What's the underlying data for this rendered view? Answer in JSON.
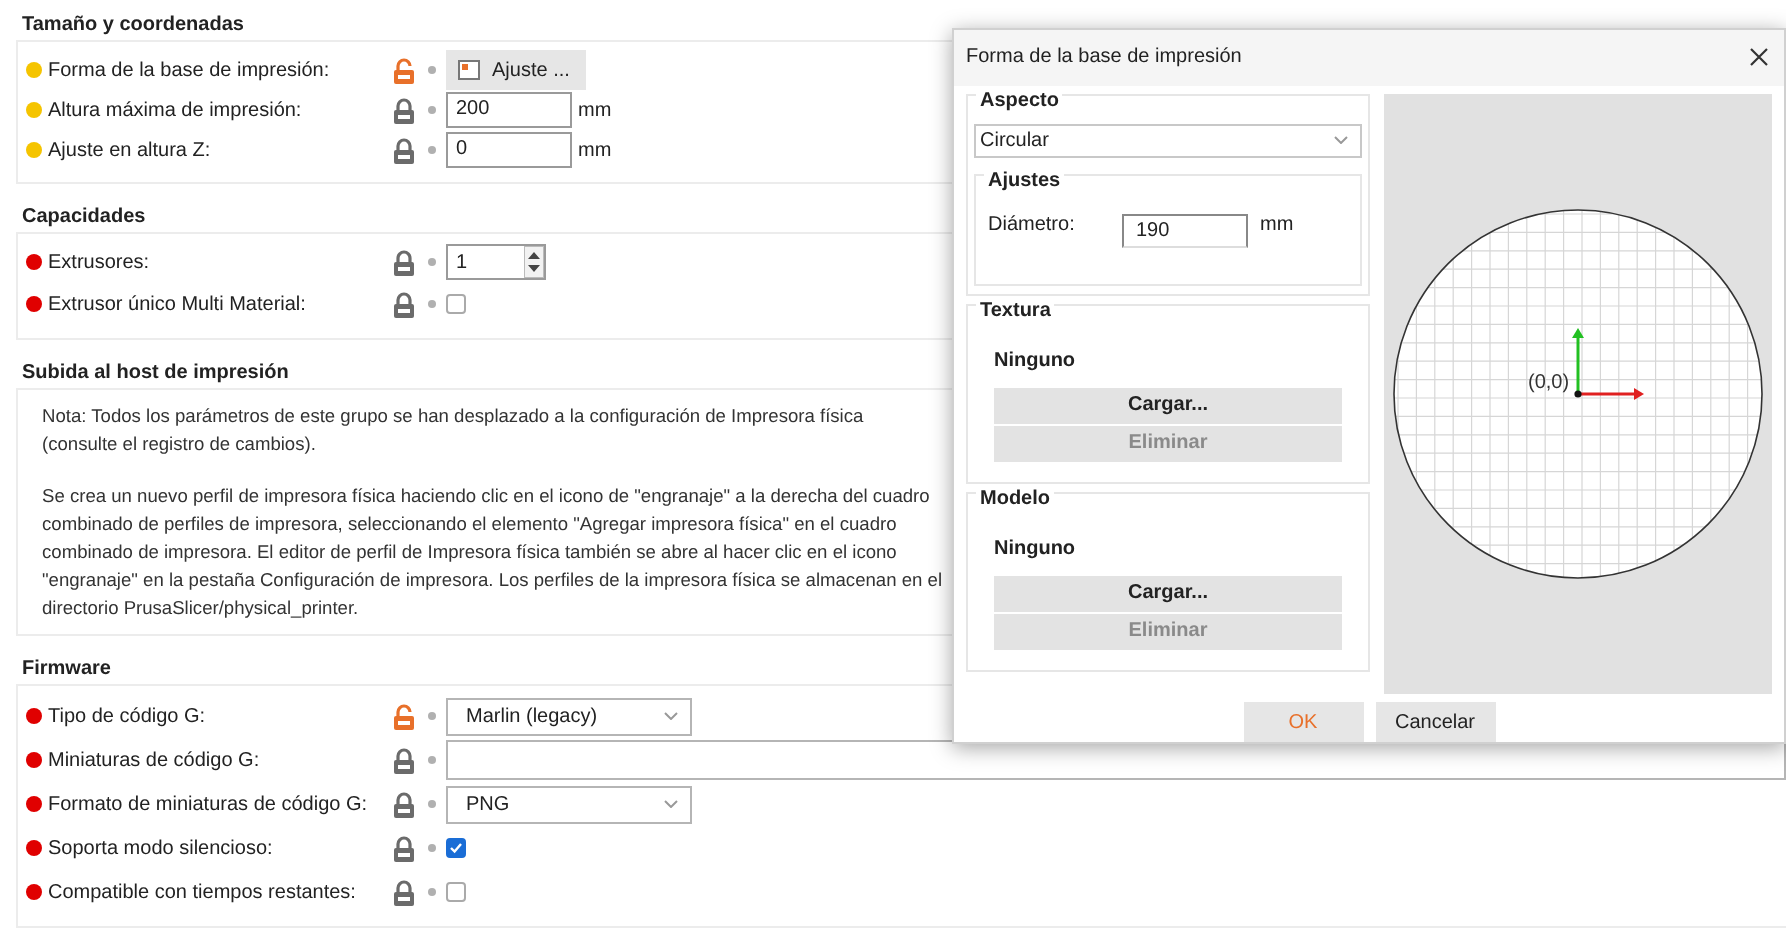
{
  "sections": [
    {
      "title": "Tamaño y coordenadas",
      "rows": [
        {
          "kind": "button",
          "label": "Forma de la base de impresión:",
          "color": "#f5c400",
          "locked": false,
          "value": "Ajuste ..."
        },
        {
          "kind": "field",
          "label": "Altura máxima de impresión:",
          "color": "#f5c400",
          "locked": true,
          "value": "200",
          "unit": "mm"
        },
        {
          "kind": "field",
          "label": "Ajuste en altura Z:",
          "color": "#f5c400",
          "locked": true,
          "value": "0",
          "unit": "mm"
        }
      ]
    },
    {
      "title": "Capacidades",
      "rows": [
        {
          "kind": "spin",
          "label": "Extrusores:",
          "color": "#e00000",
          "locked": true,
          "value": "1"
        },
        {
          "kind": "checkbox",
          "label": "Extrusor único Multi Material:",
          "color": "#e00000",
          "locked": true,
          "checked": false
        }
      ]
    },
    {
      "title": "Subida al host de impresión",
      "paragraphs": [
        "Nota: Todos los parámetros de este grupo se han desplazado a la configuración de Impresora física (consulte el registro de cambios).",
        "Se crea un nuevo perfil de impresora física haciendo clic en el icono de \"engranaje\" a la derecha del cuadro combinado de perfiles de impresora, seleccionando el elemento \"Agregar impresora física\" en el cuadro combinado de impresora. El editor de perfil de Impresora física también se abre al hacer clic en el icono \"engranaje\" en la pestaña Configuración de impresora. Los perfiles de la impresora física se almacenan en el directorio PrusaSlicer/physical_printer."
      ]
    },
    {
      "title": "Firmware",
      "rows": [
        {
          "kind": "combo",
          "label": "Tipo de código G:",
          "color": "#e00000",
          "locked": false,
          "value": "Marlin (legacy)"
        },
        {
          "kind": "text",
          "label": "Miniaturas de código G:",
          "color": "#e00000",
          "locked": true
        },
        {
          "kind": "combo",
          "label": "Formato de miniaturas de código G:",
          "color": "#e00000",
          "locked": true,
          "value": "PNG"
        },
        {
          "kind": "checkbox",
          "label": "Soporta modo silencioso:",
          "color": "#e00000",
          "locked": true,
          "checked": true
        },
        {
          "kind": "checkbox",
          "label": "Compatible con tiempos restantes:",
          "color": "#e00000",
          "locked": true,
          "checked": false
        }
      ]
    }
  ],
  "dialog": {
    "title": "Forma de la base de impresión",
    "shape": {
      "title": "Aspecto",
      "value": "Circular",
      "settings": {
        "title": "Ajustes",
        "label": "Diámetro:",
        "value": "190",
        "unit": "mm"
      }
    },
    "groups": [
      {
        "title": "Textura",
        "file": "Ninguno",
        "buttons": [
          {
            "label": "Cargar...",
            "disabled": false
          },
          {
            "label": "Eliminar",
            "disabled": true
          }
        ]
      },
      {
        "title": "Modelo",
        "file": "Ninguno",
        "buttons": [
          {
            "label": "Cargar...",
            "disabled": false
          },
          {
            "label": "Eliminar",
            "disabled": true
          }
        ]
      }
    ],
    "preview": {
      "origin_label": "(0,0)"
    },
    "buttons": [
      {
        "label": "OK",
        "default": true
      },
      {
        "label": "Cancelar",
        "default": false
      }
    ]
  }
}
